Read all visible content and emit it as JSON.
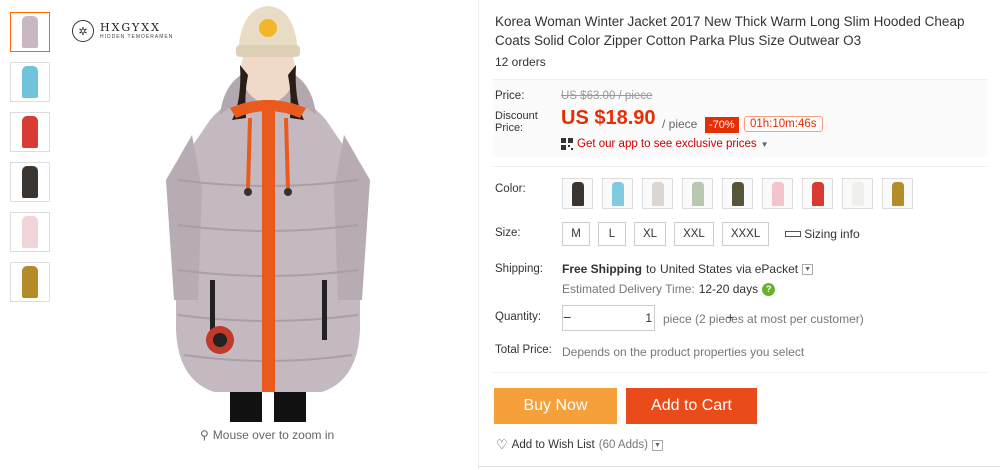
{
  "brand": {
    "name": "HXGYXX",
    "tagline": "HIDDEN TEMOERAMEN"
  },
  "gallery": {
    "zoom_hint": "Mouse over to zoom in",
    "thumb_colors": [
      "#c9b8c2",
      "#6fc4dc",
      "#d83b33",
      "#3b3631",
      "#efd4d8",
      "#b58a28"
    ]
  },
  "product": {
    "title": "Korea Woman Winter Jacket 2017 New Thick Warm Long Slim Hooded Cheap Coats Solid Color Zipper Cotton Parka Plus Size Outwear O3",
    "orders": "12 orders"
  },
  "price": {
    "label": "Price:",
    "original": "US $63.00 / piece",
    "discount_label": "Discount Price:",
    "current": "US $18.90",
    "unit": "/ piece",
    "discount": "-70%",
    "timer": "01h:10m:46s",
    "app_promo": "Get our app to see exclusive prices"
  },
  "color": {
    "label": "Color:",
    "swatches": [
      "#3a3530",
      "#7fcbe0",
      "#dcd6d2",
      "#b8c7b0",
      "#58543a",
      "#f2c4cc",
      "#d63a30",
      "#f1efec",
      "#b48c2a"
    ]
  },
  "size": {
    "label": "Size:",
    "options": [
      "M",
      "L",
      "XL",
      "XXL",
      "XXXL"
    ],
    "info": "Sizing info"
  },
  "shipping": {
    "label": "Shipping:",
    "free": "Free Shipping",
    "to": "to",
    "country": "United States",
    "via": "via ePacket",
    "delivery_label": "Estimated Delivery Time:",
    "delivery_days": "12-20 days"
  },
  "quantity": {
    "label": "Quantity:",
    "value": "1",
    "minus": "−",
    "plus": "+",
    "note": "piece (2 pieces at most per customer)"
  },
  "total": {
    "label": "Total Price:",
    "note": "Depends on the product properties you select"
  },
  "actions": {
    "buy": "Buy Now",
    "cart": "Add to Cart",
    "wish": "Add to Wish List",
    "wish_count": "(60 Adds)"
  }
}
